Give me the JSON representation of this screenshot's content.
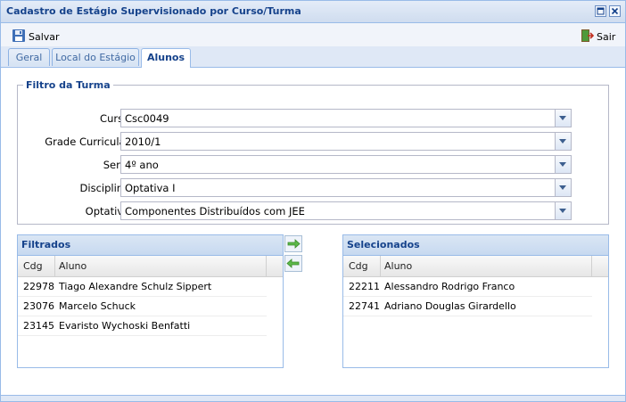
{
  "window": {
    "title": "Cadastro de Estágio Supervisionado por Curso/Turma"
  },
  "toolbar": {
    "save_label": "Salvar",
    "exit_label": "Sair"
  },
  "tabs": [
    {
      "label": "Geral"
    },
    {
      "label": "Local do Estágio"
    },
    {
      "label": "Alunos",
      "active": true
    }
  ],
  "filter": {
    "legend": "Filtro da Turma",
    "fields": [
      {
        "label": "Curso:",
        "value": "Csc0049"
      },
      {
        "label": "Grade Curricular:",
        "value": "2010/1"
      },
      {
        "label": "Serie:",
        "value": "4º ano"
      },
      {
        "label": "Disciplina:",
        "value": "Optativa I"
      },
      {
        "label": "Optativa:",
        "value": "Componentes Distribuídos com JEE"
      }
    ]
  },
  "filtered": {
    "title": "Filtrados",
    "columns": [
      "Cdg",
      "Aluno"
    ],
    "rows": [
      {
        "cdg": "22978",
        "aluno": "Tiago Alexandre Schulz Sippert"
      },
      {
        "cdg": "23076",
        "aluno": "Marcelo Schuck"
      },
      {
        "cdg": "23145",
        "aluno": "Evaristo Wychoski Benfatti"
      }
    ]
  },
  "selected": {
    "title": "Selecionados",
    "columns": [
      "Cdg",
      "Aluno"
    ],
    "rows": [
      {
        "cdg": "22211",
        "aluno": "Alessandro Rodrigo Franco"
      },
      {
        "cdg": "22741",
        "aluno": "Adriano Douglas Girardello"
      }
    ]
  },
  "colors": {
    "accent": "#15428b",
    "border": "#99bbe8",
    "arrow": "#4aa03a"
  }
}
